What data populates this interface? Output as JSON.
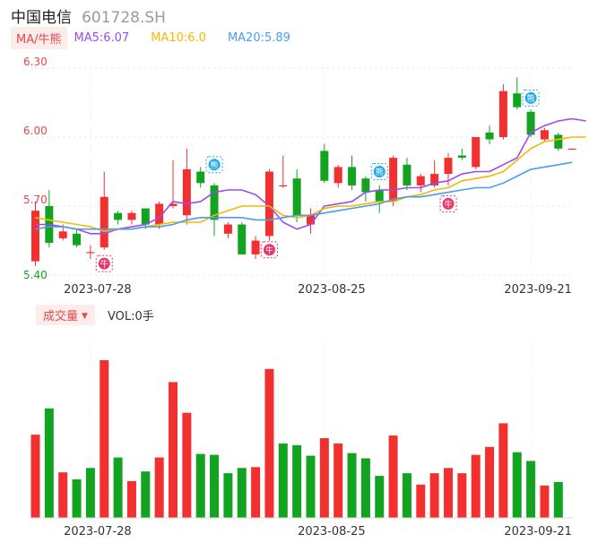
{
  "header": {
    "name": "中国电信",
    "code": "601728.SH"
  },
  "ma_legend": {
    "tag": "MA/牛熊",
    "ma5": "MA5:6.07",
    "ma10": "MA10:6.0",
    "ma20": "MA20:5.89"
  },
  "volume_legend": {
    "tag": "成交量",
    "value": "VOL:0手"
  },
  "colors": {
    "up": "#f23030",
    "down": "#12a320",
    "ma5": "#9a4cf0",
    "ma10": "#f5b800",
    "ma20": "#4a9cf0",
    "bull_badge": "#e8356e",
    "bear_badge": "#1fa8e8"
  },
  "chart_data": [
    {
      "type": "candlestick",
      "title": "",
      "ylim": [
        5.4,
        6.3
      ],
      "y_ticks": [
        "6.30",
        "6.00",
        "5.70",
        "5.40"
      ],
      "x_ticks": [
        {
          "index": 4,
          "label": "2023-07-28"
        },
        {
          "index": 21,
          "label": "2023-08-25"
        },
        {
          "index": 36,
          "label": "2023-09-21"
        }
      ],
      "candles": [
        {
          "open": 5.46,
          "close": 5.68,
          "high": 5.72,
          "low": 5.44
        },
        {
          "open": 5.7,
          "close": 5.54,
          "high": 5.77,
          "low": 5.52
        },
        {
          "open": 5.56,
          "close": 5.59,
          "high": 5.62,
          "low": 5.55
        },
        {
          "open": 5.58,
          "close": 5.53,
          "high": 5.6,
          "low": 5.52
        },
        {
          "open": 5.5,
          "close": 5.5,
          "high": 5.53,
          "low": 5.47
        },
        {
          "open": 5.52,
          "close": 5.74,
          "high": 5.85,
          "low": 5.51
        },
        {
          "open": 5.67,
          "close": 5.64,
          "high": 5.68,
          "low": 5.62
        },
        {
          "open": 5.64,
          "close": 5.67,
          "high": 5.68,
          "low": 5.62
        },
        {
          "open": 5.69,
          "close": 5.62,
          "high": 5.69,
          "low": 5.6
        },
        {
          "open": 5.62,
          "close": 5.71,
          "high": 5.72,
          "low": 5.6
        },
        {
          "open": 5.7,
          "close": 5.71,
          "high": 5.9,
          "low": 5.69
        },
        {
          "open": 5.66,
          "close": 5.86,
          "high": 5.95,
          "low": 5.62
        },
        {
          "open": 5.85,
          "close": 5.8,
          "high": 5.87,
          "low": 5.78
        },
        {
          "open": 5.79,
          "close": 5.64,
          "high": 5.8,
          "low": 5.57
        },
        {
          "open": 5.58,
          "close": 5.62,
          "high": 5.63,
          "low": 5.56
        },
        {
          "open": 5.62,
          "close": 5.49,
          "high": 5.63,
          "low": 5.49
        },
        {
          "open": 5.49,
          "close": 5.55,
          "high": 5.57,
          "low": 5.47
        },
        {
          "open": 5.57,
          "close": 5.85,
          "high": 5.86,
          "low": 5.55
        },
        {
          "open": 5.79,
          "close": 5.79,
          "high": 5.92,
          "low": 5.78
        },
        {
          "open": 5.82,
          "close": 5.66,
          "high": 5.86,
          "low": 5.63
        },
        {
          "open": 5.62,
          "close": 5.66,
          "high": 5.69,
          "low": 5.58
        },
        {
          "open": 5.94,
          "close": 5.81,
          "high": 5.97,
          "low": 5.8
        },
        {
          "open": 5.8,
          "close": 5.87,
          "high": 5.88,
          "low": 5.78
        },
        {
          "open": 5.87,
          "close": 5.79,
          "high": 5.92,
          "low": 5.77
        },
        {
          "open": 5.82,
          "close": 5.76,
          "high": 5.83,
          "low": 5.72
        },
        {
          "open": 5.77,
          "close": 5.72,
          "high": 5.79,
          "low": 5.67
        },
        {
          "open": 5.72,
          "close": 5.91,
          "high": 5.92,
          "low": 5.7
        },
        {
          "open": 5.88,
          "close": 5.79,
          "high": 5.91,
          "low": 5.77
        },
        {
          "open": 5.79,
          "close": 5.83,
          "high": 5.84,
          "low": 5.76
        },
        {
          "open": 5.79,
          "close": 5.84,
          "high": 5.9,
          "low": 5.78
        },
        {
          "open": 5.84,
          "close": 5.91,
          "high": 5.93,
          "low": 5.79
        },
        {
          "open": 5.92,
          "close": 5.91,
          "high": 5.95,
          "low": 5.9
        },
        {
          "open": 5.87,
          "close": 6.0,
          "high": 6.0,
          "low": 5.86
        },
        {
          "open": 6.02,
          "close": 5.99,
          "high": 6.05,
          "low": 5.97
        },
        {
          "open": 6.0,
          "close": 6.2,
          "high": 6.23,
          "low": 5.99
        },
        {
          "open": 6.19,
          "close": 6.13,
          "high": 6.26,
          "low": 6.12
        },
        {
          "open": 6.11,
          "close": 6.01,
          "high": 6.12,
          "low": 6.0
        },
        {
          "open": 5.99,
          "close": 6.03,
          "high": 6.04,
          "low": 5.98
        },
        {
          "open": 6.01,
          "close": 5.95,
          "high": 6.02,
          "low": 5.94
        },
        {
          "open": 5.95,
          "close": 5.95,
          "high": 5.95,
          "low": 5.95
        }
      ],
      "series": [
        {
          "key": "ma5",
          "values": [
            5.62,
            5.62,
            5.61,
            5.6,
            5.58,
            5.58,
            5.6,
            5.61,
            5.62,
            5.65,
            5.72,
            5.71,
            5.72,
            5.76,
            5.77,
            5.77,
            5.75,
            5.7,
            5.63,
            5.6,
            5.62,
            5.7,
            5.71,
            5.72,
            5.76,
            5.77,
            5.77,
            5.78,
            5.78,
            5.8,
            5.81,
            5.84,
            5.85,
            5.85,
            5.88,
            5.91,
            6.02,
            6.05,
            6.07,
            6.08,
            6.07
          ]
        },
        {
          "key": "ma10",
          "values": [
            5.65,
            5.64,
            5.63,
            5.62,
            5.61,
            5.59,
            5.6,
            5.6,
            5.61,
            5.62,
            5.63,
            5.63,
            5.63,
            5.66,
            5.68,
            5.7,
            5.7,
            5.7,
            5.66,
            5.65,
            5.66,
            5.69,
            5.7,
            5.7,
            5.71,
            5.72,
            5.72,
            5.74,
            5.75,
            5.77,
            5.78,
            5.81,
            5.82,
            5.83,
            5.85,
            5.9,
            5.95,
            5.98,
            5.99,
            6.0,
            6.0
          ]
        },
        {
          "key": "ma20",
          "values": [
            5.6,
            5.61,
            5.61,
            5.6,
            5.6,
            5.6,
            5.6,
            5.6,
            5.61,
            5.61,
            5.62,
            5.64,
            5.65,
            5.65,
            5.65,
            5.65,
            5.64,
            5.64,
            5.65,
            5.66,
            5.66,
            5.67,
            5.68,
            5.69,
            5.7,
            5.71,
            5.73,
            5.74,
            5.74,
            5.75,
            5.76,
            5.77,
            5.78,
            5.78,
            5.8,
            5.83,
            5.86,
            5.87,
            5.88,
            5.89
          ]
        }
      ],
      "markers": [
        {
          "index": 5,
          "type": "bull",
          "price": 5.45
        },
        {
          "index": 13,
          "type": "bear",
          "price": 5.88
        },
        {
          "index": 17,
          "type": "bull",
          "price": 5.51
        },
        {
          "index": 25,
          "type": "bear",
          "price": 5.85
        },
        {
          "index": 30,
          "type": "bull",
          "price": 5.71
        },
        {
          "index": 36,
          "type": "bear",
          "price": 6.17
        }
      ]
    },
    {
      "type": "bar",
      "title": "",
      "ylim": [
        0,
        180
      ],
      "x_ticks": [
        {
          "index": 4,
          "label": "2023-07-28"
        },
        {
          "index": 21,
          "label": "2023-08-25"
        },
        {
          "index": 36,
          "label": "2023-09-21"
        }
      ],
      "values": [
        95,
        125,
        52,
        44,
        57,
        180,
        69,
        42,
        53,
        69,
        155,
        120,
        73,
        72,
        51,
        57,
        58,
        170,
        85,
        83,
        71,
        91,
        85,
        74,
        68,
        48,
        94,
        51,
        38,
        51,
        57,
        51,
        72,
        81,
        108,
        75,
        65,
        37,
        41
      ],
      "directions": [
        "up",
        "down",
        "up",
        "down",
        "down",
        "up",
        "down",
        "up",
        "down",
        "up",
        "up",
        "up",
        "down",
        "down",
        "down",
        "down",
        "up",
        "up",
        "down",
        "down",
        "down",
        "up",
        "up",
        "down",
        "down",
        "down",
        "up",
        "down",
        "up",
        "up",
        "up",
        "up",
        "up",
        "up",
        "up",
        "down",
        "down",
        "up",
        "down"
      ]
    }
  ],
  "badge_labels": {
    "bull": "牛",
    "bear": "熊"
  }
}
